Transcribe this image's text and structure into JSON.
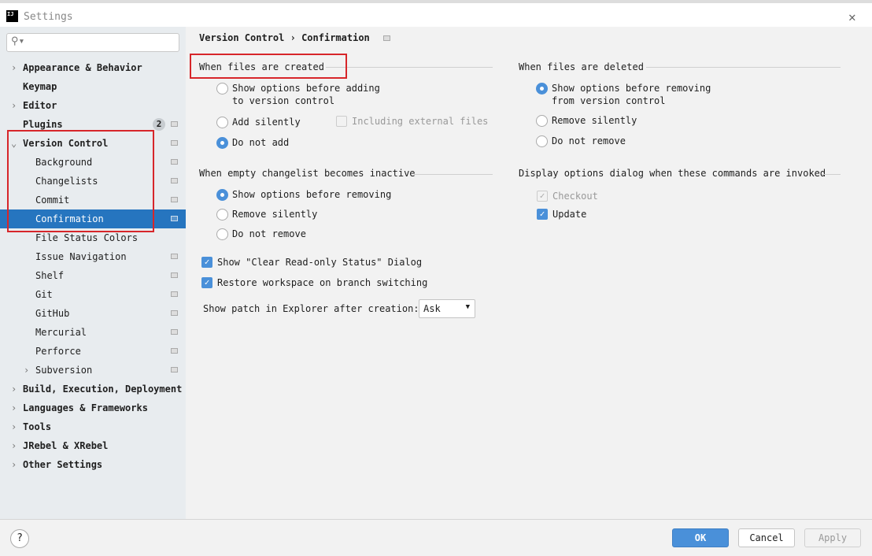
{
  "window": {
    "title": "Settings",
    "logo": "IJ"
  },
  "sidebar": {
    "items": [
      {
        "label": "Appearance & Behavior",
        "bold": true,
        "arrow": ">"
      },
      {
        "label": "Keymap",
        "bold": true
      },
      {
        "label": "Editor",
        "bold": true,
        "arrow": ">"
      },
      {
        "label": "Plugins",
        "bold": true,
        "badge": "2",
        "page": true
      },
      {
        "label": "Version Control",
        "bold": true,
        "arrow": "v",
        "page": true
      },
      {
        "label": "Background",
        "indent": true,
        "page": true
      },
      {
        "label": "Changelists",
        "indent": true,
        "page": true
      },
      {
        "label": "Commit",
        "indent": true,
        "page": true
      },
      {
        "label": "Confirmation",
        "indent": true,
        "page": true,
        "selected": true
      },
      {
        "label": "File Status Colors",
        "indent": true
      },
      {
        "label": "Issue Navigation",
        "indent": true,
        "page": true
      },
      {
        "label": "Shelf",
        "indent": true,
        "page": true
      },
      {
        "label": "Git",
        "indent": true,
        "page": true
      },
      {
        "label": "GitHub",
        "indent": true,
        "page": true
      },
      {
        "label": "Mercurial",
        "indent": true,
        "page": true
      },
      {
        "label": "Perforce",
        "indent": true,
        "page": true
      },
      {
        "label": "Subversion",
        "indent": true,
        "arrow": ">",
        "page": true
      },
      {
        "label": "Build, Execution, Deployment",
        "bold": true,
        "arrow": ">"
      },
      {
        "label": "Languages & Frameworks",
        "bold": true,
        "arrow": ">"
      },
      {
        "label": "Tools",
        "bold": true,
        "arrow": ">"
      },
      {
        "label": "JRebel & XRebel",
        "bold": true,
        "arrow": ">"
      },
      {
        "label": "Other Settings",
        "bold": true,
        "arrow": ">"
      }
    ]
  },
  "breadcrumb": {
    "parent": "Version Control",
    "sep": "›",
    "current": "Confirmation"
  },
  "created": {
    "title": "When files are created",
    "opt1a": "Show options before adding",
    "opt1b": "to version control",
    "opt2": "Add silently",
    "external": "Including external files",
    "opt3": "Do not add",
    "selected": 3
  },
  "deleted": {
    "title": "When files are deleted",
    "opt1a": "Show options before removing",
    "opt1b": "from version control",
    "opt2": "Remove silently",
    "opt3": "Do not remove",
    "selected": 1
  },
  "empty": {
    "title": "When empty changelist becomes inactive",
    "opt1": "Show options before removing",
    "opt2": "Remove silently",
    "opt3": "Do not remove",
    "selected": 1
  },
  "display": {
    "title": "Display options dialog when these commands are invoked",
    "checkout": "Checkout",
    "update": "Update"
  },
  "checks": {
    "readonly": "Show \"Clear Read-only Status\" Dialog",
    "restore": "Restore workspace on branch switching"
  },
  "patch": {
    "label": "Show patch in Explorer after creation:",
    "value": "Ask"
  },
  "footer": {
    "help": "?",
    "ok": "OK",
    "cancel": "Cancel",
    "apply": "Apply"
  },
  "colors": {
    "accent": "#2675bf",
    "highlight": "#d7262a",
    "ok": "#4a90d9"
  }
}
